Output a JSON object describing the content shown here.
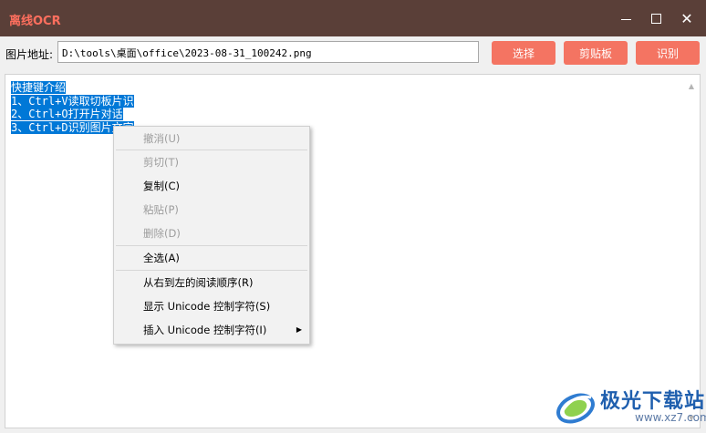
{
  "window": {
    "title": "离线OCR",
    "title_color": "#ff6f5e",
    "titlebar_color": "#5a3f38",
    "controls": {
      "minimize_icon": "minimize-icon",
      "maximize_icon": "maximize-icon",
      "close_icon": "close-icon",
      "close_glyph": "✕"
    }
  },
  "toolbar": {
    "path_label": "图片地址:",
    "path_value": "D:\\tools\\桌面\\office\\2023-08-31_100242.png",
    "choose_label": "选择",
    "clipboard_label": "剪贴板",
    "recognize_label": "识别",
    "button_color": "#f47462"
  },
  "editor": {
    "lines": [
      "快捷键介绍",
      "1、Ctrl+V读取切板片识",
      "2、Ctrl+O打开片对话",
      "3、Ctrl+D识别图片文字"
    ],
    "selection_color": "#0078d7",
    "scroll_up_glyph": "▲",
    "scroll_down_glyph": "▼"
  },
  "context_menu": {
    "items": [
      {
        "label": "撤消(U)",
        "enabled": false
      },
      {
        "label": "剪切(T)",
        "enabled": false
      },
      {
        "label": "复制(C)",
        "enabled": true
      },
      {
        "label": "粘贴(P)",
        "enabled": false
      },
      {
        "label": "删除(D)",
        "enabled": false
      },
      {
        "label": "全选(A)",
        "enabled": true
      },
      {
        "label": "从右到左的阅读顺序(R)",
        "enabled": true
      },
      {
        "label": "显示 Unicode 控制字符(S)",
        "enabled": true
      },
      {
        "label": "插入 Unicode 控制字符(I)",
        "enabled": true
      }
    ],
    "submenu_arrow": "▶"
  },
  "watermark": {
    "name": "极光下载站",
    "url": "www.xz7.com",
    "logo_icon": "aurora-logo-icon"
  }
}
